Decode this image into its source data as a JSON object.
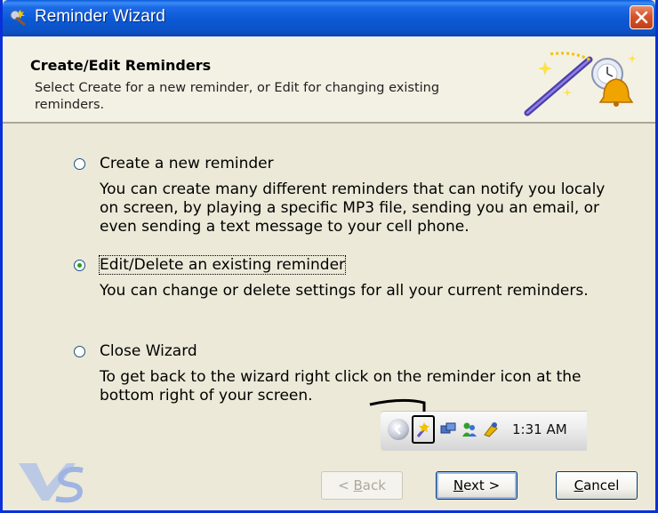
{
  "window": {
    "title": "Reminder Wizard",
    "accent_color": "#0b58d4",
    "close_icon": "close-icon"
  },
  "header": {
    "title": "Create/Edit Reminders",
    "description": "Select Create for a new reminder, or Edit for changing existing reminders.",
    "art_icon": "magic-wand-bell-icon"
  },
  "options": [
    {
      "label": "Create a new reminder",
      "checked": false,
      "description": "You can create many different reminders that can notify you localy on screen, by playing a specific MP3 file, sending you an email, or even sending a text message to your cell phone."
    },
    {
      "label": "Edit/Delete an existing reminder",
      "checked": true,
      "description": "You can change or delete settings for all your current reminders."
    },
    {
      "label": "Close Wizard",
      "checked": false,
      "description": "To get back to the wizard right click on the reminder icon at the bottom right of your screen."
    }
  ],
  "tray": {
    "clock": "1:31 AM"
  },
  "buttons": {
    "back_pre": "< ",
    "back_ul": "B",
    "back_post": "ack",
    "next_ul": "N",
    "next_post": "ext >",
    "cancel_ul": "C",
    "cancel_post": "ancel"
  }
}
